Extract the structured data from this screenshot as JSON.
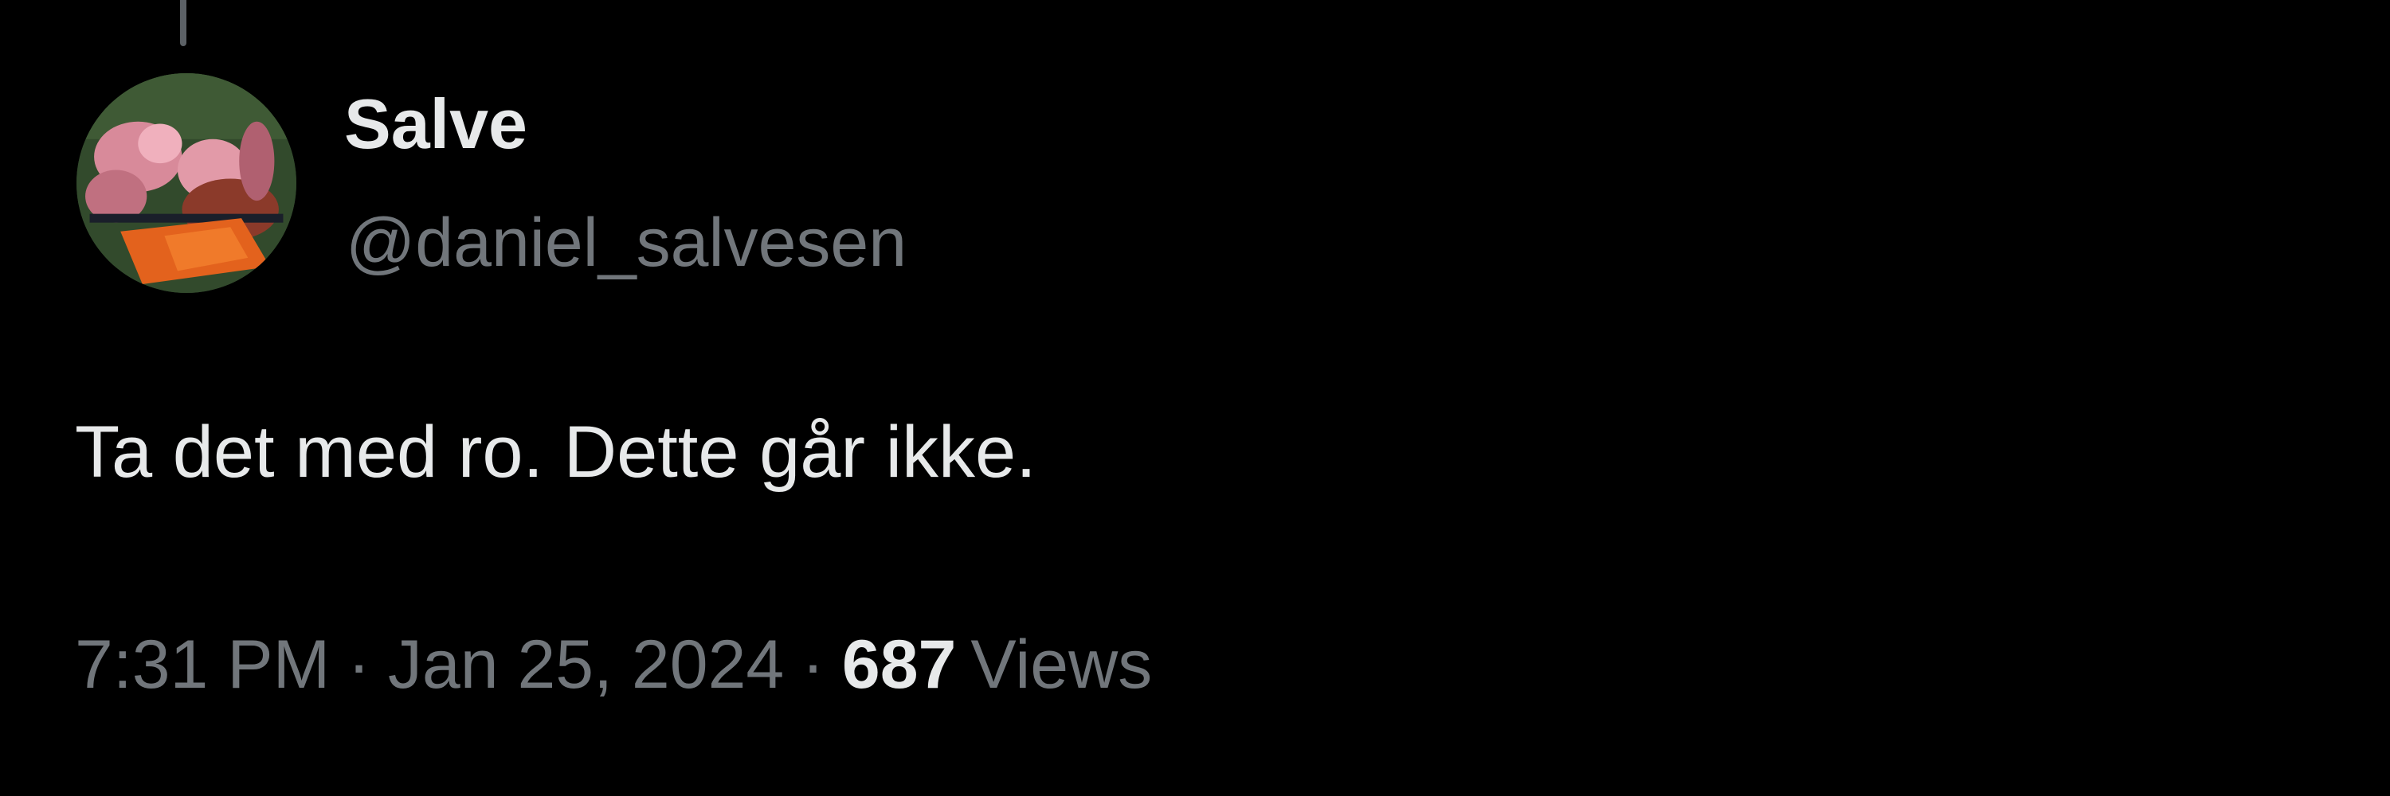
{
  "tweet": {
    "author": {
      "display_name": "Salve",
      "handle": "@daniel_salvesen",
      "avatar_icon": "profile-photo"
    },
    "text": "Ta det med ro. Dette går ikke.",
    "time": "7:31 PM",
    "separator": "·",
    "date": "Jan 25, 2024",
    "views_count": "687",
    "views_label": "Views"
  },
  "colors": {
    "background": "#000000",
    "primary_text": "#e7e9ea",
    "secondary_text": "#71767b",
    "thread_line": "#5c6166"
  }
}
